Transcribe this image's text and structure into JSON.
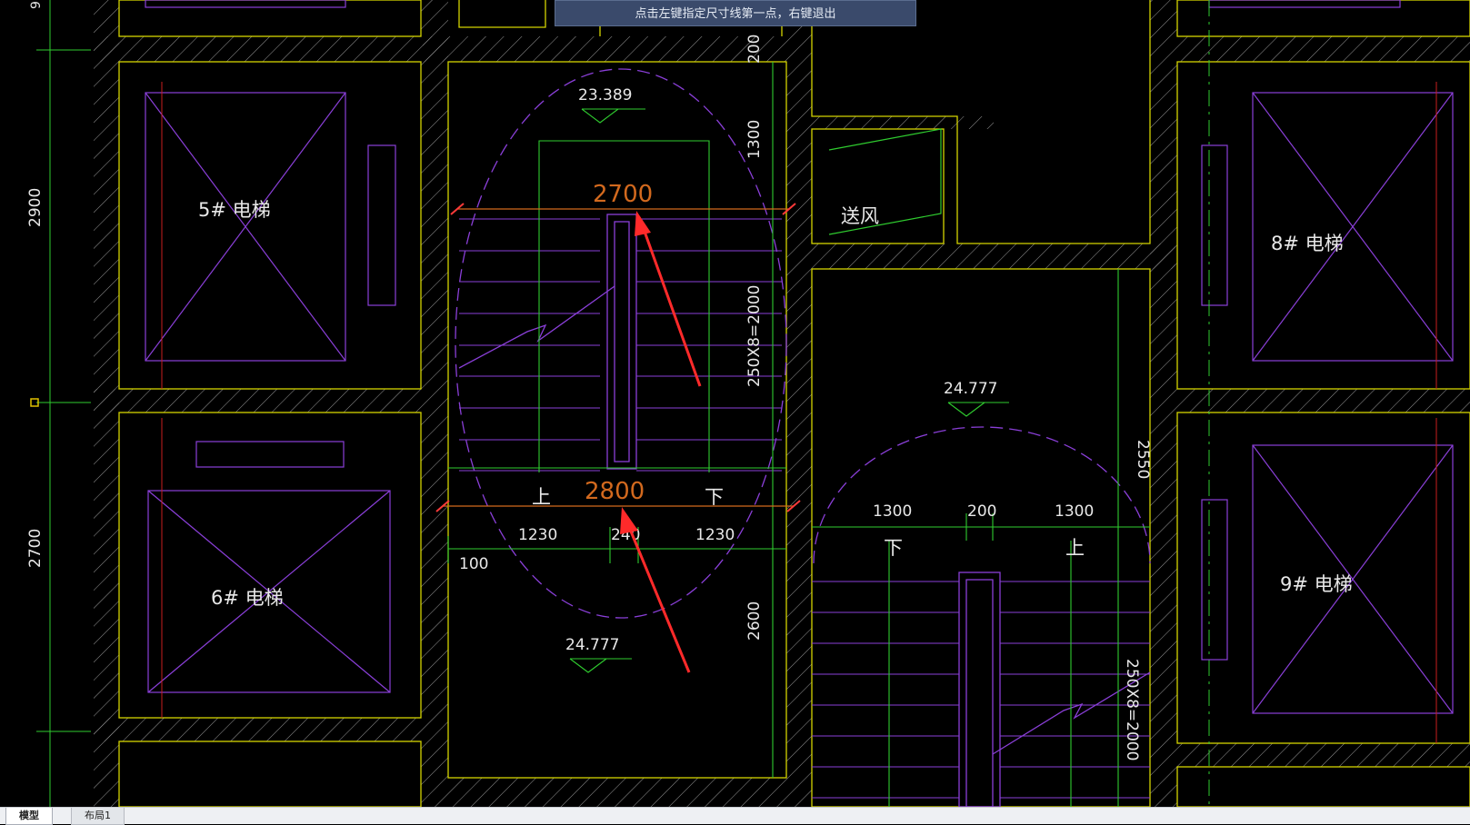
{
  "prompt": {
    "text": "点击左键指定尺寸线第一点，右键退出"
  },
  "tabs": [
    {
      "label": "模型",
      "active": true
    },
    {
      "label": "布局1",
      "active": false
    }
  ],
  "rooms": {
    "elevator5": "5# 电梯",
    "elevator6": "6# 电梯",
    "elevator8": "8# 电梯",
    "elevator9": "9# 电梯",
    "supply_air": "送风"
  },
  "elevations": {
    "stair1_top": "23.389",
    "stair1_bottom": "24.777",
    "stair2_top": "24.777"
  },
  "dimensions": {
    "measured_top": "2700",
    "measured_bottom": "2800",
    "left_axis_top": "2900",
    "left_axis_bottom": "2700",
    "left_axis_edge": "9",
    "stair1_v_200": "200",
    "stair1_v_1300": "1300",
    "stair1_v_steps": "250X8=2000",
    "stair1_v_2600": "2600",
    "stair1_h_left": "1230",
    "stair1_h_mid": "240",
    "stair1_h_right": "1230",
    "stair1_h_100": "100",
    "stair2_h_left": "1300",
    "stair2_h_mid": "200",
    "stair2_h_right": "1300",
    "stair2_v_2550": "2550",
    "stair2_v_steps": "250X8=2000"
  },
  "stair_labels": {
    "up": "上",
    "down": "下"
  },
  "colors": {
    "wall": "#d4d400",
    "purple": "#8a3fd8",
    "green": "#2fcc2f",
    "white_text": "#e8e8e8",
    "orange_dim": "#d2691e",
    "axis_red": "#c81e1e",
    "arrow": "#ff2a2a"
  }
}
